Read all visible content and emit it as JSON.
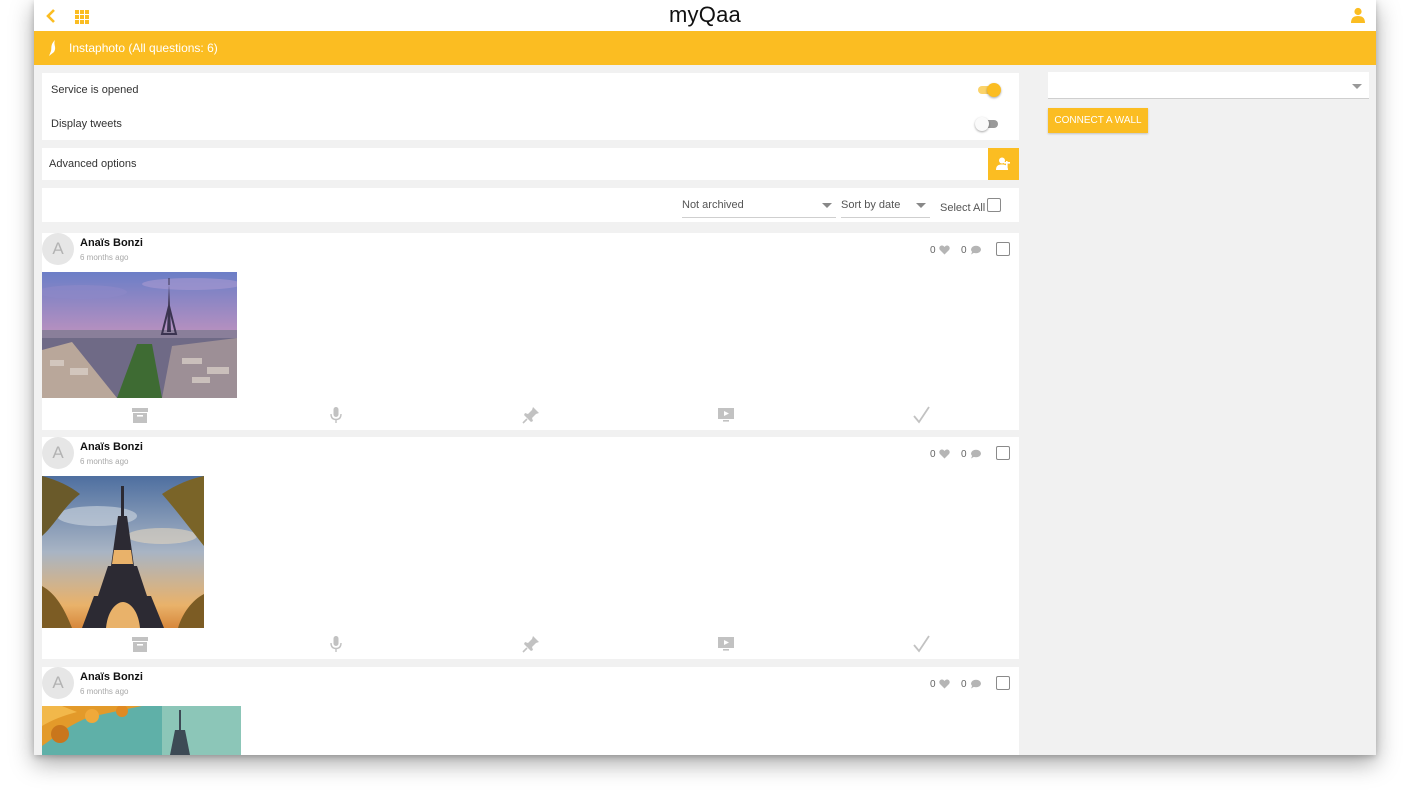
{
  "header": {
    "app_title": "myQaa",
    "icons": {
      "back": "chevron-left-icon",
      "grid": "grid-icon",
      "user": "user-icon"
    }
  },
  "banner": {
    "title": "Instaphoto (All questions: 6)",
    "icon": "service-icon"
  },
  "settings": {
    "service_opened": {
      "label": "Service is opened",
      "on": true
    },
    "display_tweets": {
      "label": "Display tweets",
      "on": false
    }
  },
  "advanced": {
    "label": "Advanced options",
    "button_icon": "user-settings-icon"
  },
  "filters": {
    "archive": "Not archived",
    "sort": "Sort by date",
    "select_all": "Select All"
  },
  "posts": [
    {
      "author": "Anaïs Bonzi",
      "avatar_letter": "A",
      "time": "6 months ago",
      "likes": "0",
      "comments": "0",
      "image": "paris-skyline-eiffel-tower"
    },
    {
      "author": "Anaïs Bonzi",
      "avatar_letter": "A",
      "time": "6 months ago",
      "likes": "0",
      "comments": "0",
      "image": "eiffel-tower-sunset"
    },
    {
      "author": "Anaïs Bonzi",
      "avatar_letter": "A",
      "time": "6 months ago",
      "likes": "0",
      "comments": "0",
      "image": "eiffel-tower-autumn"
    }
  ],
  "post_actions": [
    "archive-icon",
    "microphone-icon",
    "pin-icon",
    "screen-icon",
    "checkmark-icon"
  ],
  "wall": {
    "select_value": "",
    "connect_label": "CONNECT A WALL"
  },
  "colors": {
    "accent": "#fbbd22",
    "background": "#f1f1f1",
    "card": "#ffffff"
  }
}
